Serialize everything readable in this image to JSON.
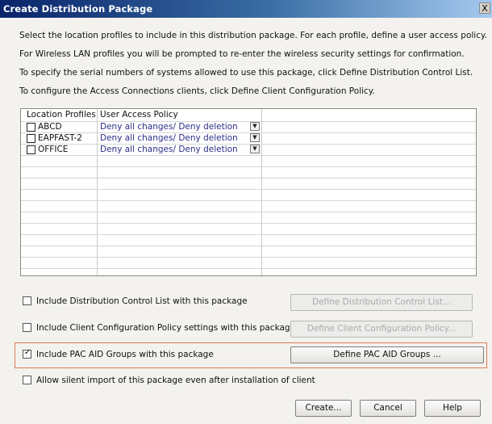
{
  "window": {
    "title": "Create Distribution Package",
    "close_label": "X"
  },
  "instructions": [
    "Select the location profiles to include in this distribution package. For each profile, define a user access policy.",
    "For Wireless LAN profiles you will be prompted to re-enter the wireless security settings for confirmation.",
    "To specify the serial numbers of systems allowed to use this package, click Define Distribution Control List.",
    "To configure the Access Connections clients, click Define Client Configuration Policy."
  ],
  "table": {
    "columns": [
      "Location Profiles",
      "User Access Policy"
    ],
    "rows": [
      {
        "profile": "ABCD",
        "policy": "Deny all changes/ Deny deletion",
        "checked": false
      },
      {
        "profile": "EAPFAST-2",
        "policy": "Deny all changes/ Deny deletion",
        "checked": false
      },
      {
        "profile": "OFFICE",
        "policy": "Deny all changes/ Deny deletion",
        "checked": false
      }
    ]
  },
  "options": {
    "dcl": {
      "label": "Include Distribution Control List with this package",
      "checked": false
    },
    "ccp": {
      "label": "Include Client Configuration Policy settings with this package",
      "checked": false
    },
    "pac": {
      "label": "Include PAC AID Groups with this package",
      "checked": true
    },
    "silent": {
      "label": "Allow silent import of this package even after installation of client",
      "checked": false
    }
  },
  "buttons": {
    "define_dcl": "Define Distribution Control List...",
    "define_ccp": "Define Client Configuration Policy...",
    "define_pac": "Define PAC AID Groups ...",
    "create": "Create...",
    "cancel": "Cancel",
    "help": "Help"
  }
}
